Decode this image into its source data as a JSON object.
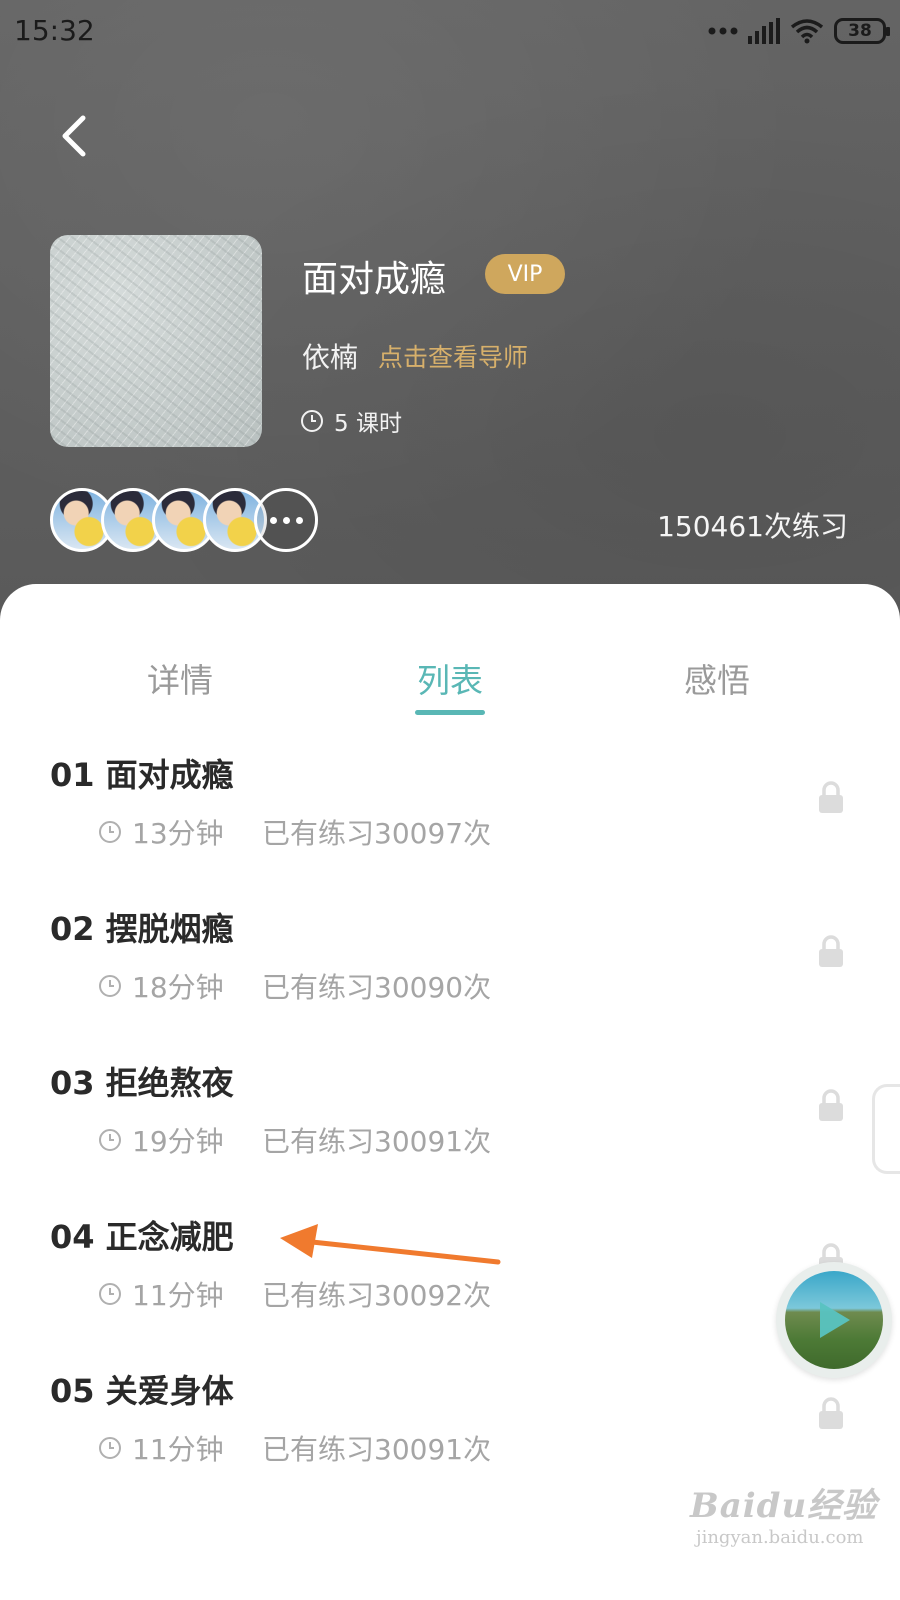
{
  "status_bar": {
    "time": "15:32",
    "battery": "38"
  },
  "course": {
    "title": "面对成瘾",
    "vip": "VIP",
    "teacher": "依楠",
    "view_teacher": "点击查看导师",
    "lessons": "5 课时",
    "practice_count": "150461次练习"
  },
  "tabs": [
    {
      "label": "详情"
    },
    {
      "label": "列表",
      "active": true
    },
    {
      "label": "感悟"
    }
  ],
  "lesson_list": [
    {
      "title": "01 面对成瘾",
      "duration": "13分钟",
      "count": "已有练习30097次",
      "locked": true
    },
    {
      "title": "02 摆脱烟瘾",
      "duration": "18分钟",
      "count": "已有练习30090次",
      "locked": true
    },
    {
      "title": "03 拒绝熬夜",
      "duration": "19分钟",
      "count": "已有练习30091次",
      "locked": true
    },
    {
      "title": "04 正念减肥",
      "duration": "11分钟",
      "count": "已有练习30092次",
      "locked": true
    },
    {
      "title": "05 关爱身体",
      "duration": "11分钟",
      "count": "已有练习30091次",
      "locked": true
    }
  ],
  "watermark": {
    "main": "Baidu经验",
    "sub": "jingyan.baidu.com"
  },
  "colors": {
    "accent": "#59b7b5",
    "vip": "#cfa75d",
    "teacher_link": "#d7b06b",
    "arrow": "#f07a2e"
  },
  "icons": [
    "back-icon",
    "signal-icon",
    "wifi-icon",
    "battery-icon",
    "clock-icon",
    "lock-icon",
    "play-icon",
    "more-icon"
  ]
}
